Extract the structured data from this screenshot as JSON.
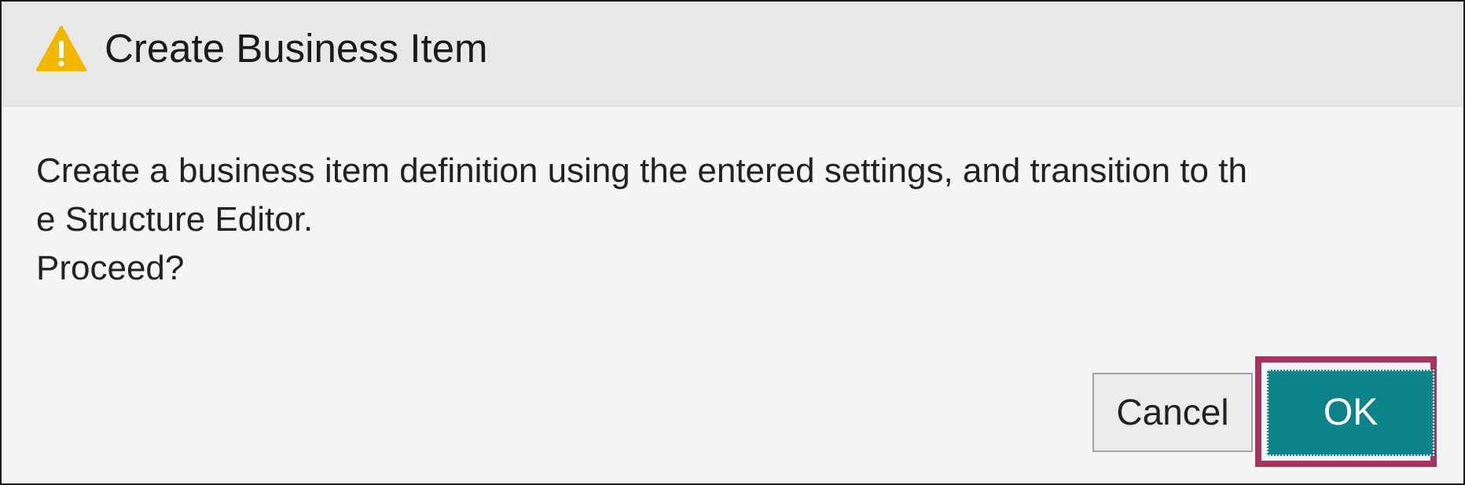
{
  "dialog": {
    "title": "Create Business Item",
    "title_icon": "warning-icon",
    "message_lines": [
      "Create a business item definition using the entered settings, and transition to th",
      "e Structure Editor.",
      "Proceed?"
    ],
    "buttons": {
      "cancel_label": "Cancel",
      "ok_label": "OK"
    }
  },
  "colors": {
    "title_bar_bg": "#e8e8e8",
    "body_bg": "#f5f5f5",
    "warning_icon": "#f2b800",
    "ok_button": "#0f838a",
    "highlight_frame": "#a6345f"
  }
}
